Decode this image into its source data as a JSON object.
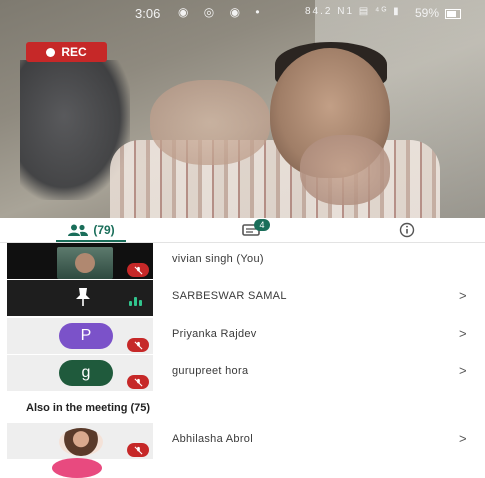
{
  "status_bar": {
    "time": "3:06",
    "left_icons": "◉ ◎ ◉ •",
    "right_icons": "84.2 N1 ▤ ⁴ᴳ ▮",
    "battery": "59%"
  },
  "recording": {
    "label": "REC"
  },
  "tabs": {
    "people_count": "(79)",
    "chat_badge": "4"
  },
  "participants": [
    {
      "name": "vivian singh (You)",
      "tile": "video",
      "mic": "off",
      "chevron": ""
    },
    {
      "name": "SARBESWAR SAMAL",
      "tile": "pinned",
      "mic": "speaking",
      "chevron": ">"
    },
    {
      "name": "Priyanka Rajdev",
      "tile": "avatar",
      "initial": "P",
      "avatar_color": "#7b52c9",
      "mic": "off",
      "chevron": ">"
    },
    {
      "name": "gurupreet hora",
      "tile": "avatar",
      "initial": "g",
      "avatar_color": "#1f5a3c",
      "mic": "off",
      "chevron": ">"
    }
  ],
  "also_in_meeting": {
    "title": "Also in the meeting (75)",
    "participants": [
      {
        "name": "Abhilasha Abrol",
        "tile": "photo",
        "mic": "off",
        "chevron": ">"
      }
    ]
  },
  "colors": {
    "accent": "#1a6e5a",
    "rec": "#c62828",
    "mic_off": "#c62828",
    "speaking": "#31c48d"
  }
}
